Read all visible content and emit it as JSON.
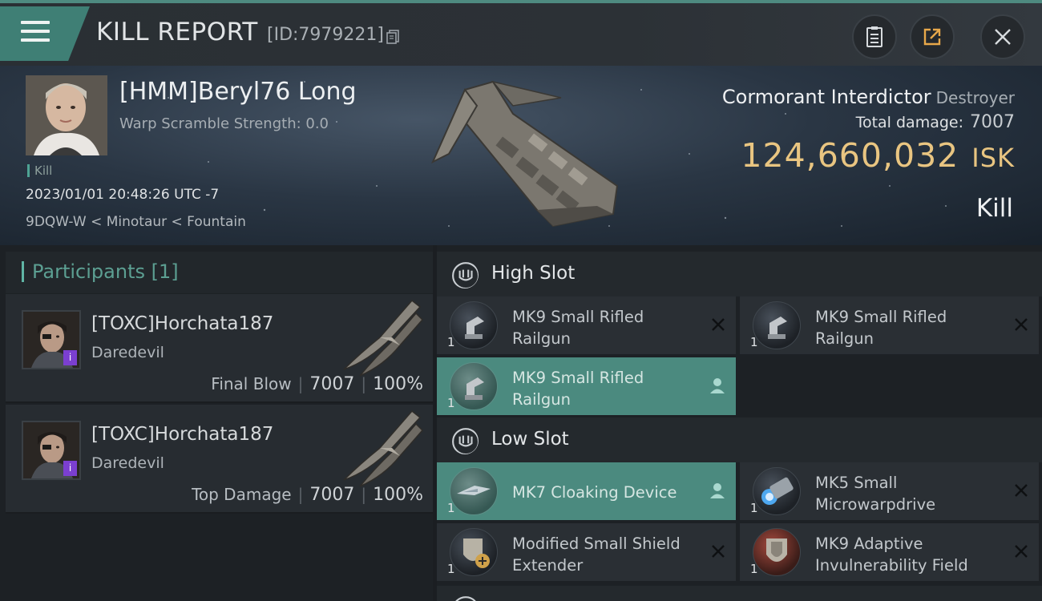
{
  "header": {
    "title": "KILL REPORT",
    "report_id": "[ID:7979221]"
  },
  "victim": {
    "name": "[HMM]Beryl76 Long",
    "warp_scramble": "Warp Scramble Strength: 0.0",
    "kill_tag": "Kill",
    "datetime": "2023/01/01 20:48:26 UTC -7",
    "location": "9DQW-W < Minotaur < Fountain",
    "ship_name": "Cormorant Interdictor",
    "ship_class": "Destroyer",
    "total_damage_label": "Total damage:",
    "total_damage": "7007",
    "isk_value": "124,660,032",
    "isk_unit": "ISK",
    "result": "Kill"
  },
  "participants": {
    "title": "Participants",
    "count": "[1]",
    "rows": [
      {
        "name": "[TOXC]Horchata187",
        "ship": "Daredevil",
        "role": "Final Blow",
        "damage": "7007",
        "percent": "100%"
      },
      {
        "name": "[TOXC]Horchata187",
        "ship": "Daredevil",
        "role": "Top Damage",
        "damage": "7007",
        "percent": "100%"
      }
    ]
  },
  "fitting": {
    "high_slot": {
      "label": "High Slot",
      "items": [
        {
          "line1": "MK9 Small Rifled",
          "line2": "Railgun",
          "qty": "1"
        },
        {
          "line1": "MK9 Small Rifled",
          "line2": "Railgun",
          "qty": "1"
        },
        {
          "line1": "MK9 Small Rifled",
          "line2": "Railgun",
          "qty": "1"
        }
      ]
    },
    "low_slot": {
      "label": "Low Slot",
      "items": [
        {
          "line1": "MK7 Cloaking Device",
          "qty": "1"
        },
        {
          "line1": "MK5 Small",
          "line2": "Microwarpdrive",
          "qty": "1"
        },
        {
          "line1": "Modified Small Shield",
          "line2": "Extender",
          "qty": "1"
        },
        {
          "line1": "MK9 Adaptive",
          "line2": "Invulnerability Field",
          "qty": "1"
        }
      ]
    }
  },
  "colors": {
    "accent": "#4b8a7f",
    "isk": "#e9c581",
    "omega_badge": "#7b3fd0"
  },
  "icons": [
    "menu-icon",
    "copy-icon",
    "clipboard-icon",
    "share-icon",
    "close-icon",
    "slot-icon",
    "remove-icon",
    "pilot-icon"
  ]
}
